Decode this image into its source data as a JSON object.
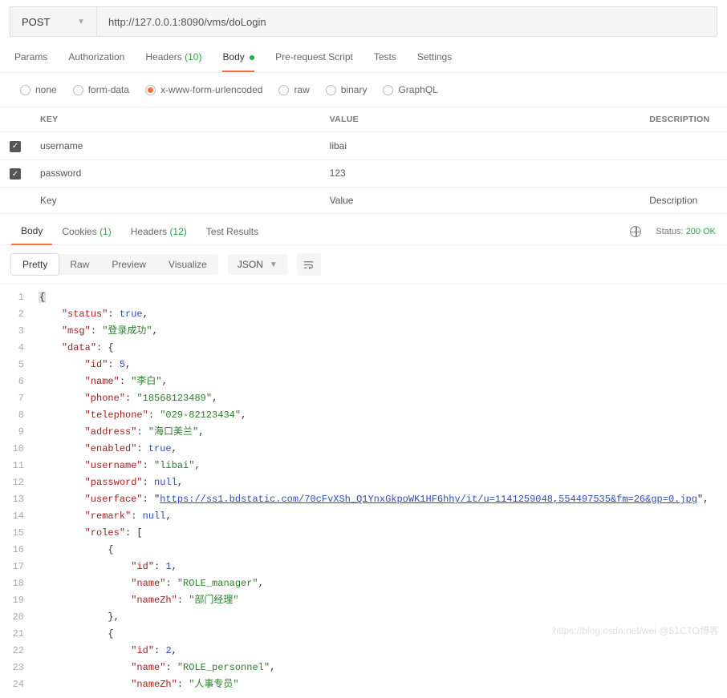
{
  "request": {
    "method": "POST",
    "url": "http://127.0.0.1:8090/vms/doLogin"
  },
  "tabs": {
    "params_label": "Params",
    "authorization_label": "Authorization",
    "headers_label": "Headers",
    "headers_count": "(10)",
    "body_label": "Body",
    "prerequest_label": "Pre-request Script",
    "tests_label": "Tests",
    "settings_label": "Settings"
  },
  "body_types": {
    "none": "none",
    "form_data": "form-data",
    "urlencoded": "x-www-form-urlencoded",
    "raw": "raw",
    "binary": "binary",
    "graphql": "GraphQL"
  },
  "params_table": {
    "headers": {
      "key": "KEY",
      "value": "VALUE",
      "description": "DESCRIPTION"
    },
    "rows": [
      {
        "key": "username",
        "value": "libai"
      },
      {
        "key": "password",
        "value": "123"
      }
    ],
    "placeholders": {
      "key": "Key",
      "value": "Value",
      "description": "Description"
    }
  },
  "response_tabs": {
    "body": "Body",
    "cookies": "Cookies",
    "cookies_count": "(1)",
    "headers": "Headers",
    "headers_count": "(12)",
    "test_results": "Test Results",
    "status_label": "Status:",
    "status_value": "200 OK"
  },
  "formatter": {
    "pretty": "Pretty",
    "raw": "Raw",
    "preview": "Preview",
    "visualize": "Visualize",
    "lang": "JSON"
  },
  "json_lines": [
    {
      "n": 1,
      "ind": 0,
      "tokens": [
        {
          "t": "p",
          "v": "{",
          "hl": true
        }
      ]
    },
    {
      "n": 2,
      "ind": 1,
      "tokens": [
        {
          "t": "k",
          "v": "\"status\""
        },
        {
          "t": "p",
          "v": ": "
        },
        {
          "t": "b",
          "v": "true"
        },
        {
          "t": "p",
          "v": ","
        }
      ]
    },
    {
      "n": 3,
      "ind": 1,
      "tokens": [
        {
          "t": "k",
          "v": "\"msg\""
        },
        {
          "t": "p",
          "v": ": "
        },
        {
          "t": "s",
          "v": "\"登录成功\""
        },
        {
          "t": "p",
          "v": ","
        }
      ]
    },
    {
      "n": 4,
      "ind": 1,
      "tokens": [
        {
          "t": "k",
          "v": "\"data\""
        },
        {
          "t": "p",
          "v": ": {"
        }
      ]
    },
    {
      "n": 5,
      "ind": 2,
      "tokens": [
        {
          "t": "k",
          "v": "\"id\""
        },
        {
          "t": "p",
          "v": ": "
        },
        {
          "t": "n",
          "v": "5"
        },
        {
          "t": "p",
          "v": ","
        }
      ]
    },
    {
      "n": 6,
      "ind": 2,
      "tokens": [
        {
          "t": "k",
          "v": "\"name\""
        },
        {
          "t": "p",
          "v": ": "
        },
        {
          "t": "s",
          "v": "\"李白\""
        },
        {
          "t": "p",
          "v": ","
        }
      ]
    },
    {
      "n": 7,
      "ind": 2,
      "tokens": [
        {
          "t": "k",
          "v": "\"phone\""
        },
        {
          "t": "p",
          "v": ": "
        },
        {
          "t": "s",
          "v": "\"18568123489\""
        },
        {
          "t": "p",
          "v": ","
        }
      ]
    },
    {
      "n": 8,
      "ind": 2,
      "tokens": [
        {
          "t": "k",
          "v": "\"telephone\""
        },
        {
          "t": "p",
          "v": ": "
        },
        {
          "t": "s",
          "v": "\"029-82123434\""
        },
        {
          "t": "p",
          "v": ","
        }
      ]
    },
    {
      "n": 9,
      "ind": 2,
      "tokens": [
        {
          "t": "k",
          "v": "\"address\""
        },
        {
          "t": "p",
          "v": ": "
        },
        {
          "t": "s",
          "v": "\"海口美兰\""
        },
        {
          "t": "p",
          "v": ","
        }
      ]
    },
    {
      "n": 10,
      "ind": 2,
      "tokens": [
        {
          "t": "k",
          "v": "\"enabled\""
        },
        {
          "t": "p",
          "v": ": "
        },
        {
          "t": "b",
          "v": "true"
        },
        {
          "t": "p",
          "v": ","
        }
      ]
    },
    {
      "n": 11,
      "ind": 2,
      "tokens": [
        {
          "t": "k",
          "v": "\"username\""
        },
        {
          "t": "p",
          "v": ": "
        },
        {
          "t": "s",
          "v": "\"libai\""
        },
        {
          "t": "p",
          "v": ","
        }
      ]
    },
    {
      "n": 12,
      "ind": 2,
      "tokens": [
        {
          "t": "k",
          "v": "\"password\""
        },
        {
          "t": "p",
          "v": ": "
        },
        {
          "t": "nul",
          "v": "null"
        },
        {
          "t": "p",
          "v": ","
        }
      ]
    },
    {
      "n": 13,
      "ind": 2,
      "tokens": [
        {
          "t": "k",
          "v": "\"userface\""
        },
        {
          "t": "p",
          "v": ": "
        },
        {
          "t": "p",
          "v": "\""
        },
        {
          "t": "url",
          "v": "https://ss1.bdstatic.com/70cFvXSh_Q1YnxGkpoWK1HF6hhy/it/u=1141259048,554497535&fm=26&gp=0.jpg"
        },
        {
          "t": "p",
          "v": "\""
        },
        {
          "t": "p",
          "v": ","
        }
      ]
    },
    {
      "n": 14,
      "ind": 2,
      "tokens": [
        {
          "t": "k",
          "v": "\"remark\""
        },
        {
          "t": "p",
          "v": ": "
        },
        {
          "t": "nul",
          "v": "null"
        },
        {
          "t": "p",
          "v": ","
        }
      ]
    },
    {
      "n": 15,
      "ind": 2,
      "tokens": [
        {
          "t": "k",
          "v": "\"roles\""
        },
        {
          "t": "p",
          "v": ": ["
        }
      ]
    },
    {
      "n": 16,
      "ind": 3,
      "tokens": [
        {
          "t": "p",
          "v": "{"
        }
      ]
    },
    {
      "n": 17,
      "ind": 4,
      "tokens": [
        {
          "t": "k",
          "v": "\"id\""
        },
        {
          "t": "p",
          "v": ": "
        },
        {
          "t": "n",
          "v": "1"
        },
        {
          "t": "p",
          "v": ","
        }
      ]
    },
    {
      "n": 18,
      "ind": 4,
      "tokens": [
        {
          "t": "k",
          "v": "\"name\""
        },
        {
          "t": "p",
          "v": ": "
        },
        {
          "t": "s",
          "v": "\"ROLE_manager\""
        },
        {
          "t": "p",
          "v": ","
        }
      ]
    },
    {
      "n": 19,
      "ind": 4,
      "tokens": [
        {
          "t": "k",
          "v": "\"nameZh\""
        },
        {
          "t": "p",
          "v": ": "
        },
        {
          "t": "s",
          "v": "\"部门经理\""
        }
      ]
    },
    {
      "n": 20,
      "ind": 3,
      "tokens": [
        {
          "t": "p",
          "v": "},"
        }
      ]
    },
    {
      "n": 21,
      "ind": 3,
      "tokens": [
        {
          "t": "p",
          "v": "{"
        }
      ]
    },
    {
      "n": 22,
      "ind": 4,
      "tokens": [
        {
          "t": "k",
          "v": "\"id\""
        },
        {
          "t": "p",
          "v": ": "
        },
        {
          "t": "n",
          "v": "2"
        },
        {
          "t": "p",
          "v": ","
        }
      ]
    },
    {
      "n": 23,
      "ind": 4,
      "tokens": [
        {
          "t": "k",
          "v": "\"name\""
        },
        {
          "t": "p",
          "v": ": "
        },
        {
          "t": "s",
          "v": "\"ROLE_personnel\""
        },
        {
          "t": "p",
          "v": ","
        }
      ]
    },
    {
      "n": 24,
      "ind": 4,
      "tokens": [
        {
          "t": "k",
          "v": "\"nameZh\""
        },
        {
          "t": "p",
          "v": ": "
        },
        {
          "t": "s",
          "v": "\"人事专员\""
        }
      ]
    }
  ],
  "watermark": "https://blog.csdn.net/wei @51CTO博客"
}
